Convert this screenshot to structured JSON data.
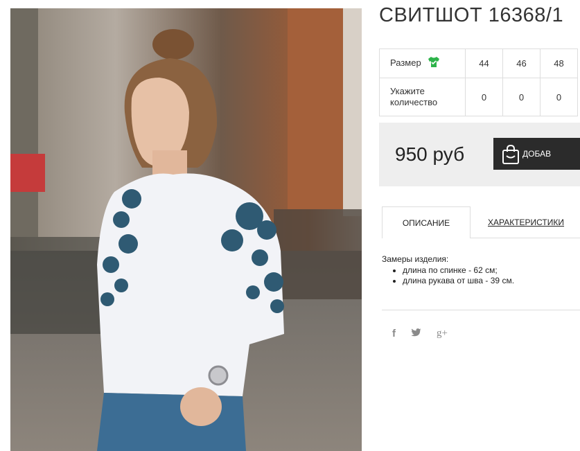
{
  "product": {
    "title": "СВИТШОТ 16368/1",
    "image_alt": "product photo: woman in white sweatshirt with blue floral print"
  },
  "sizes": {
    "size_label": "Размер",
    "size_icon": "tshirt-icon",
    "values": [
      "44",
      "46",
      "48"
    ],
    "qty_label_line1": "Укажите",
    "qty_label_line2": "количество",
    "quantities": [
      "0",
      "0",
      "0"
    ]
  },
  "purchase": {
    "price": "950 руб",
    "buy_label": "ДОБАВ",
    "bag_icon": "shopping-bag-icon"
  },
  "tabs": {
    "description": "ОПИСАНИЕ",
    "characteristics": "ХАРАКТЕРИСТИКИ"
  },
  "description": {
    "heading": "Замеры изделия:",
    "items": [
      "длина по спинке - 62 см;",
      "длина рукава от шва - 39 см."
    ]
  },
  "social": {
    "facebook": "f",
    "twitter": "twitter-icon",
    "googleplus": "g+"
  },
  "colors": {
    "accent_green": "#2db34a",
    "button_dark": "#2b2b2b",
    "price_bg": "#eeeeee"
  }
}
